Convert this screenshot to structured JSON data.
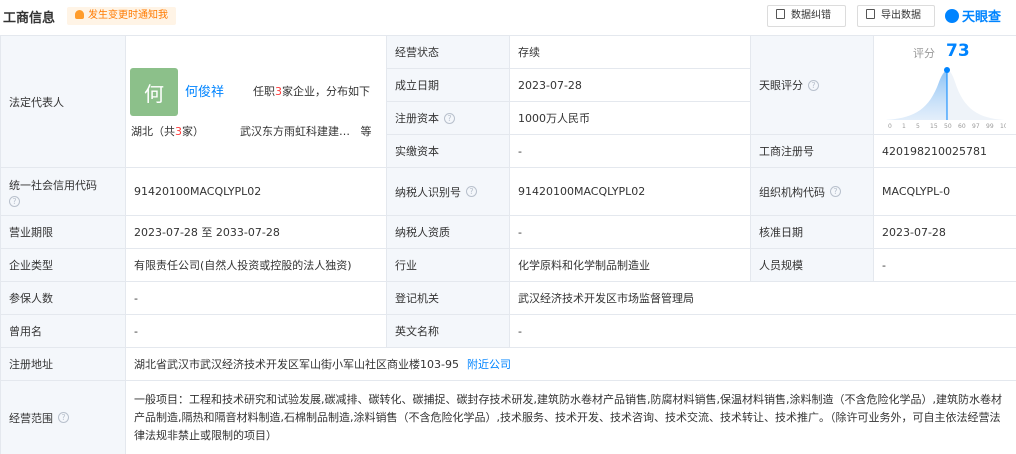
{
  "header": {
    "title": "工商信息",
    "notify_label": "发生变更时通知我",
    "correct_label": "数据纠错",
    "export_label": "导出数据",
    "brand": "天眼查"
  },
  "representative": {
    "label": "法定代表人",
    "avatar_char": "何",
    "name": "何俊祥",
    "info_pre": "任职",
    "info_count": "3",
    "info_post": "家企业，分布如下",
    "province": "湖北（共",
    "province_count": "3",
    "province_post": "家）",
    "company": "武汉东方雨虹科建建…",
    "company_more": "等"
  },
  "fields": {
    "status_label": "经营状态",
    "status": "存续",
    "founded_label": "成立日期",
    "founded": "2023-07-28",
    "capital_label": "注册资本",
    "capital": "1000万人民币",
    "paid_label": "实缴资本",
    "paid": "-",
    "score_label": "天眼评分",
    "regno_label": "工商注册号",
    "regno": "420198210025781",
    "credit_label": "统一社会信用代码",
    "credit": "91420100MACQLYPL02",
    "taxid_label": "纳税人识别号",
    "taxid": "91420100MACQLYPL02",
    "orgcode_label": "组织机构代码",
    "orgcode": "MACQLYPL-0",
    "term_label": "营业期限",
    "term": "2023-07-28 至 2033-07-28",
    "taxqual_label": "纳税人资质",
    "taxqual": "-",
    "approve_label": "核准日期",
    "approve": "2023-07-28",
    "type_label": "企业类型",
    "type": "有限责任公司(自然人投资或控股的法人独资)",
    "industry_label": "行业",
    "industry": "化学原料和化学制品制造业",
    "staff_label": "人员规模",
    "staff": "-",
    "insured_label": "参保人数",
    "insured": "-",
    "authority_label": "登记机关",
    "authority": "武汉经济技术开发区市场监督管理局",
    "former_label": "曾用名",
    "former": "-",
    "english_label": "英文名称",
    "english": "-",
    "address_label": "注册地址",
    "address": "湖北省武汉市武汉经济技术开发区军山街小军山社区商业楼103-95",
    "nearby_label": "附近公司",
    "scope_label": "经营范围",
    "scope": "一般项目：工程和技术研究和试验发展,碳减排、碳转化、碳捕捉、碳封存技术研发,建筑防水卷材产品销售,防腐材料销售,保温材料销售,涂料制造（不含危险化学品）,建筑防水卷材产品制造,隔热和隔音材料制造,石棉制品制造,涂料销售（不含危险化学品）,技术服务、技术开发、技术咨询、技术交流、技术转让、技术推广。（除许可业务外，可自主依法经营法律法规非禁止或限制的项目）"
  },
  "score": {
    "label": "评分",
    "value": 73,
    "axis": [
      "0",
      "1",
      "5",
      "15",
      "50",
      "60",
      "97",
      "99",
      "100"
    ],
    "color": "#0084ff"
  }
}
